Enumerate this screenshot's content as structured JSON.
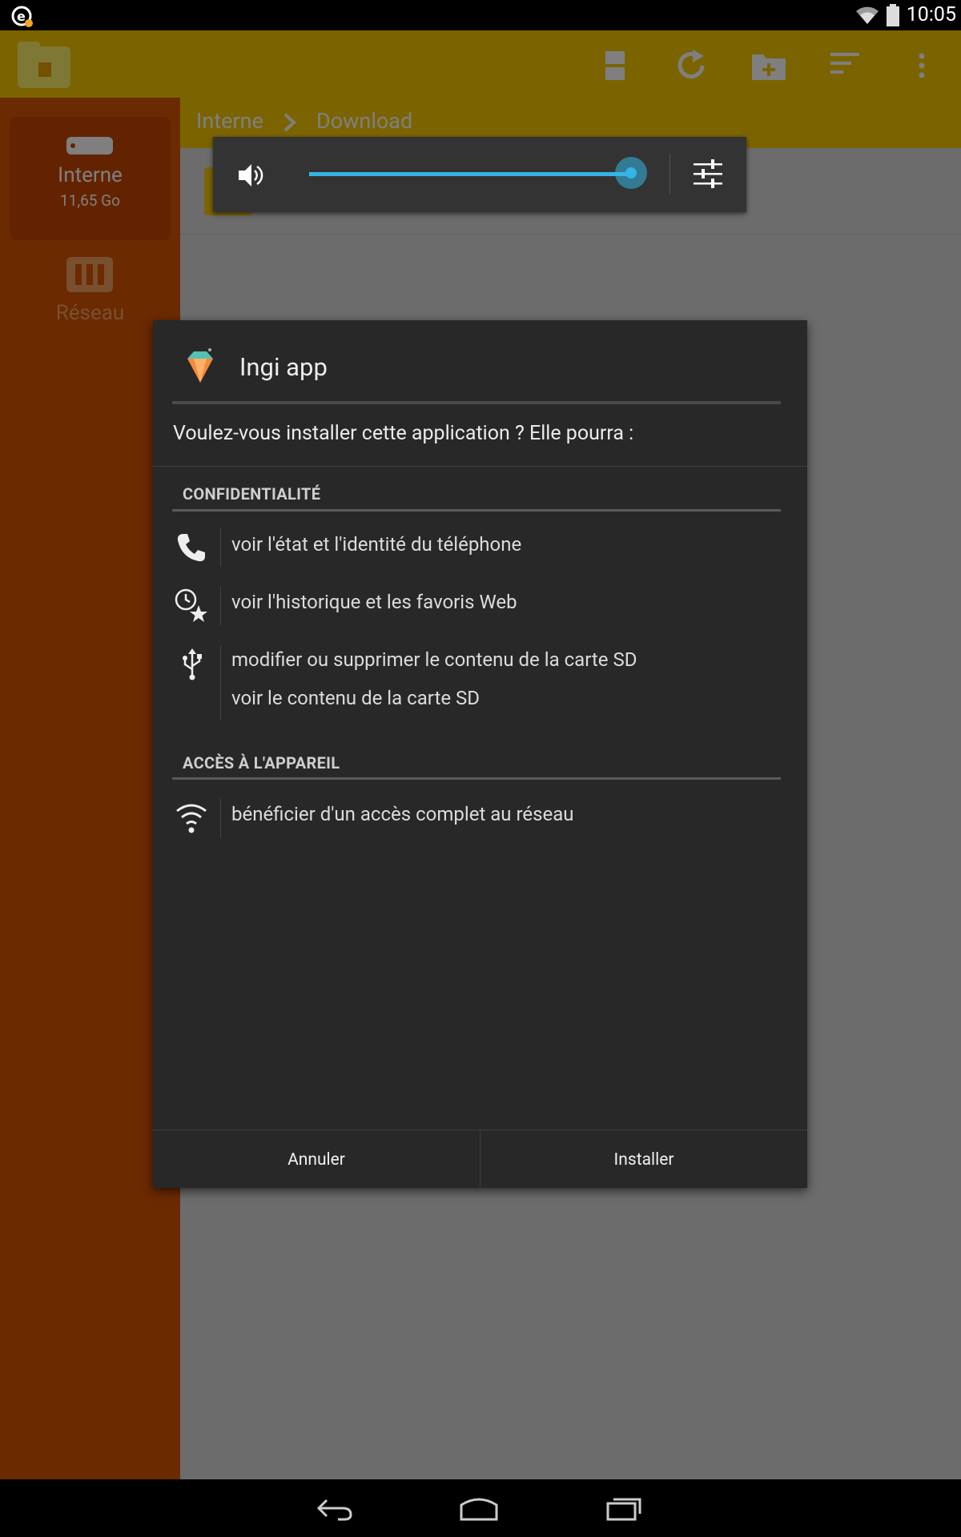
{
  "status_bar": {
    "time": "10:05",
    "icons": [
      "notification-app-icon",
      "wifi-icon",
      "battery-icon"
    ]
  },
  "action_bar": {
    "icons": [
      "folder-app-icon",
      "grid-view-icon",
      "refresh-icon",
      "new-folder-icon",
      "sort-icon",
      "overflow-menu-icon"
    ]
  },
  "breadcrumb": {
    "items": [
      "Interne",
      "Download"
    ]
  },
  "sidebar": {
    "items": [
      {
        "label": "Interne",
        "sublabel": "11,65 Go",
        "icon": "storage-icon",
        "selected": true
      },
      {
        "label": "Réseau",
        "sublabel": "",
        "icon": "network-storage-icon",
        "selected": false
      }
    ]
  },
  "volume_panel": {
    "level": 1.0,
    "icons": [
      "speaker-icon",
      "settings-sliders-icon"
    ]
  },
  "dialog": {
    "title": "Ingi app",
    "app_icon": "diamond-icon",
    "message": "Voulez-vous installer cette application ? Elle pourra :",
    "sections": [
      {
        "header": "CONFIDENTIALITÉ",
        "groups": [
          {
            "icon": "phone-icon",
            "lines": [
              "voir l'état et l'identité du téléphone"
            ]
          },
          {
            "icon": "history-bookmark-icon",
            "lines": [
              "voir l'historique et les favoris Web"
            ]
          },
          {
            "icon": "usb-icon",
            "lines": [
              "modifier ou supprimer le contenu de la carte SD",
              "voir le contenu de la carte SD"
            ]
          }
        ]
      },
      {
        "header": "ACCÈS À L'APPAREIL",
        "groups": [
          {
            "icon": "wifi-icon",
            "lines": [
              "bénéficier d'un accès complet au réseau"
            ]
          }
        ]
      }
    ],
    "cancel_label": "Annuler",
    "install_label": "Installer"
  },
  "nav_bar": {
    "icons": [
      "back-icon",
      "home-icon",
      "recent-apps-icon"
    ]
  },
  "colors": {
    "action_bar": "#f7c900",
    "sidebar": "#d85400",
    "accent": "#33b5e5",
    "dialog_bg": "#282828"
  }
}
